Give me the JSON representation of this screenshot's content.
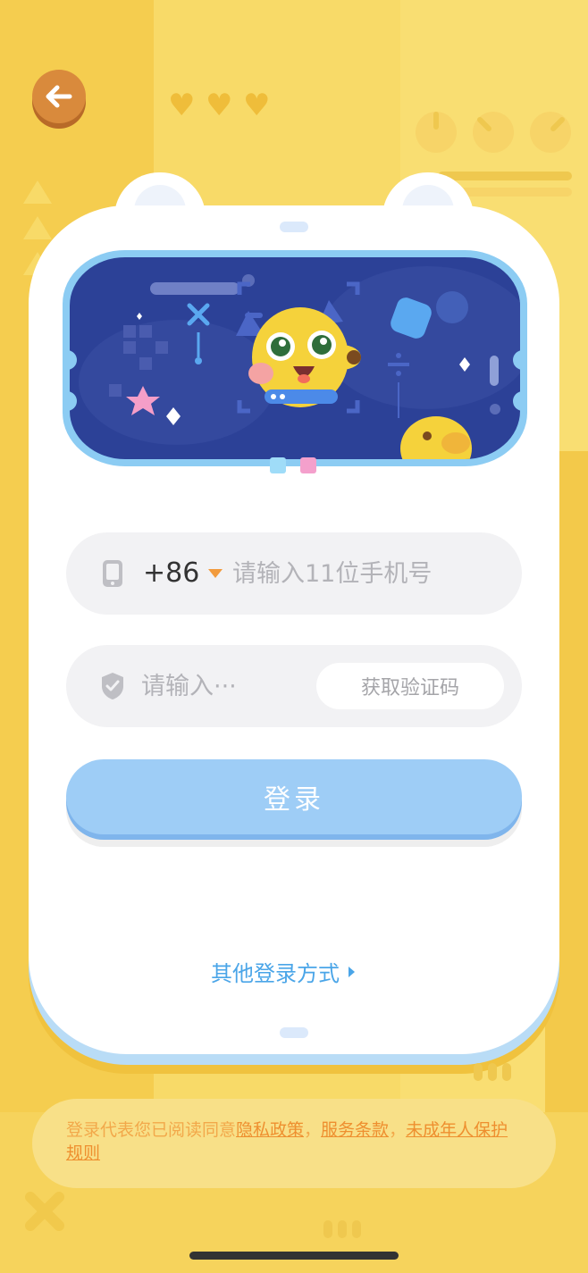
{
  "colors": {
    "background": "#f7d35a",
    "back_button": "#d98a3c",
    "card": "#ffffff",
    "screen": "#2c4197",
    "field": "#f2f2f4",
    "login_button": "#9ecdf6",
    "link_blue": "#4aa5e8",
    "legal_orange": "#ee8f2f",
    "accent_orange": "#f29b3d"
  },
  "header": {
    "back_icon": "arrow-left-icon"
  },
  "carousel": {
    "pages": 2,
    "active_index": 0,
    "dot_colors": [
      "#9fdcf8",
      "#f4a0cc"
    ]
  },
  "phone_field": {
    "icon": "phone-icon",
    "country_code": "+86",
    "placeholder": "请输入11位手机号",
    "value": ""
  },
  "code_field": {
    "icon": "shield-check-icon",
    "placeholder": "请输入···",
    "value": "",
    "get_code_label": "获取验证码"
  },
  "login_button": {
    "label": "登录"
  },
  "other_login": {
    "label": "其他登录方式"
  },
  "legal": {
    "prefix": "登录代表您已阅读同意",
    "privacy_policy": "隐私政策",
    "sep1": "，",
    "terms_of_service": "服务条款",
    "sep2": "，",
    "minor_protection": "未成年人保护规则"
  }
}
